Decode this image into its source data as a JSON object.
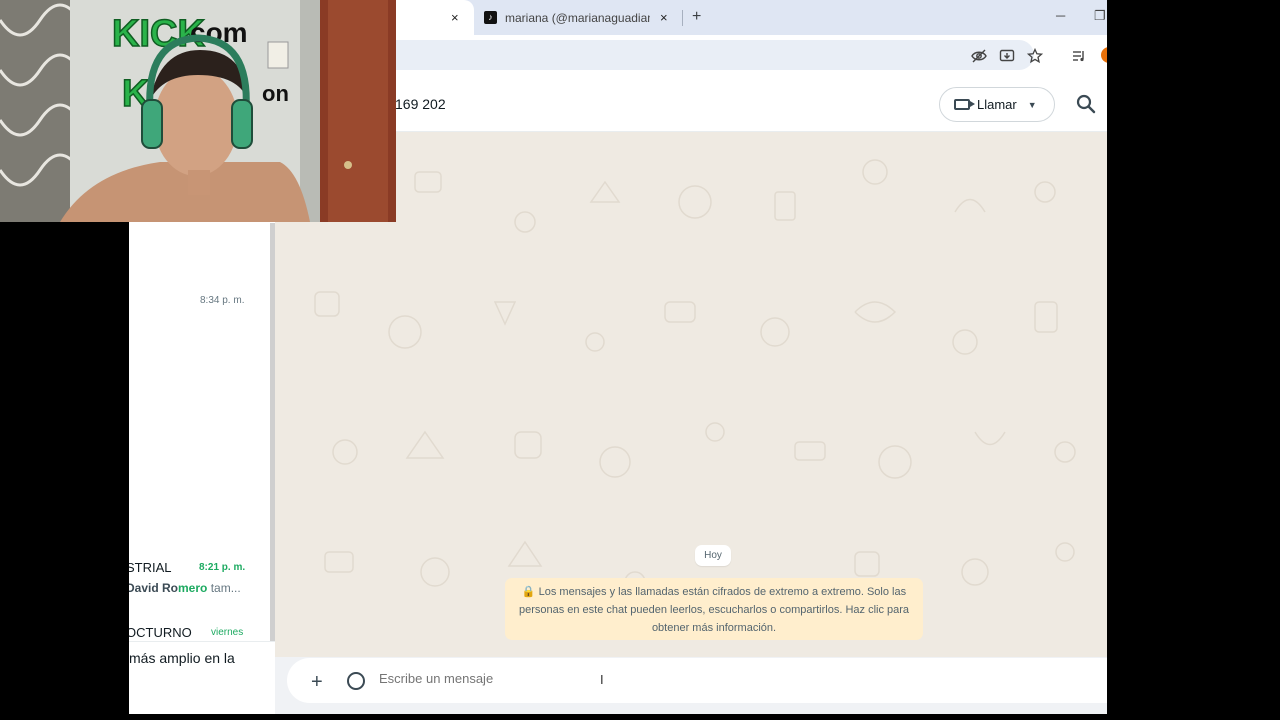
{
  "browser": {
    "tabs": [
      {
        "title": "",
        "active": true
      },
      {
        "title": "mariana (@marianaguadiamos)",
        "active": false
      }
    ],
    "new_tab": "+",
    "close_glyph": "×",
    "minimize": "─",
    "restore": "❐"
  },
  "whatsapp": {
    "header": {
      "contact_name": "169 202",
      "call_label": "Llamar"
    },
    "sidebar": {
      "time_1": "8:34 p. m.",
      "chat_2_name": "STRIAL",
      "chat_2_time": "8:21 p. m.",
      "chat_2_sender": "David Ro",
      "chat_2_sender_hl": "mero",
      "chat_2_preview": " tam...",
      "chat_3_name": "OCTURNO",
      "chat_3_time": "viernes",
      "bottom_text": "más amplio en la"
    },
    "chat": {
      "day_label": "Hoy",
      "encryption_notice": "🔒 Los mensajes y las llamadas están cifrados de extremo a extremo. Solo las personas en este chat pueden leerlos, escucharlos o compartirlos. Haz clic para obtener más información.",
      "composer_placeholder": "Escribe un mensaje"
    }
  },
  "webcam": {
    "sign_text_1": "KICK",
    "sign_text_2": "com",
    "sign_text_3": "K",
    "sign_text_4": "on"
  },
  "colors": {
    "tabstrip": "#dfe6f3",
    "chat_bg": "#efeae2",
    "accent_green": "#1daa61",
    "notice_bg": "#ffeecd"
  }
}
